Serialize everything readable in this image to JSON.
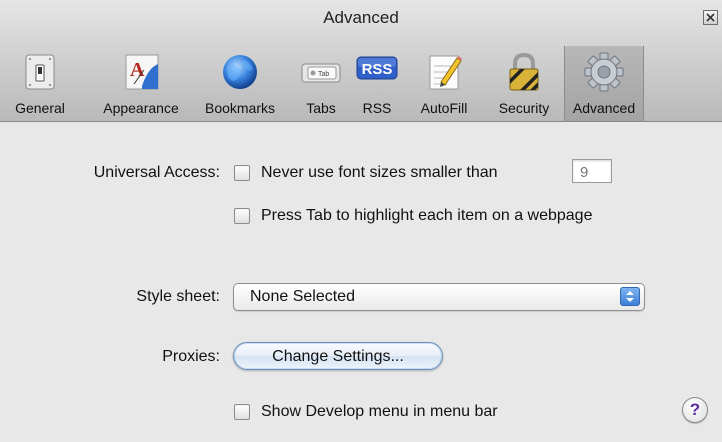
{
  "window": {
    "title": "Advanced"
  },
  "toolbar": {
    "items": [
      {
        "label": "General",
        "icon": "switch-icon"
      },
      {
        "label": "Appearance",
        "icon": "font-icon"
      },
      {
        "label": "Bookmarks",
        "icon": "globe-icon"
      },
      {
        "label": "Tabs",
        "icon": "tab-icon",
        "icon_text": "Tab"
      },
      {
        "label": "RSS",
        "icon": "rss-icon",
        "icon_text": "RSS"
      },
      {
        "label": "AutoFill",
        "icon": "pencil-form-icon"
      },
      {
        "label": "Security",
        "icon": "lock-icon"
      },
      {
        "label": "Advanced",
        "icon": "gear-icon",
        "selected": true
      }
    ]
  },
  "universal_access": {
    "label": "Universal Access:",
    "font_size_option": {
      "label": "Never use font sizes smaller than",
      "checked": false,
      "value": "9"
    },
    "tab_option": {
      "label": "Press Tab to highlight each item on a webpage",
      "checked": false
    }
  },
  "style_sheet": {
    "label": "Style sheet:",
    "selected": "None Selected"
  },
  "proxies": {
    "label": "Proxies:",
    "button_label": "Change Settings..."
  },
  "develop_menu": {
    "label": "Show Develop menu in menu bar",
    "checked": false
  },
  "help": {
    "label": "?"
  },
  "colors": {
    "accent": "#3c7fd8",
    "rss": "#2f5fc8",
    "help_glyph": "#5a2ca0"
  }
}
